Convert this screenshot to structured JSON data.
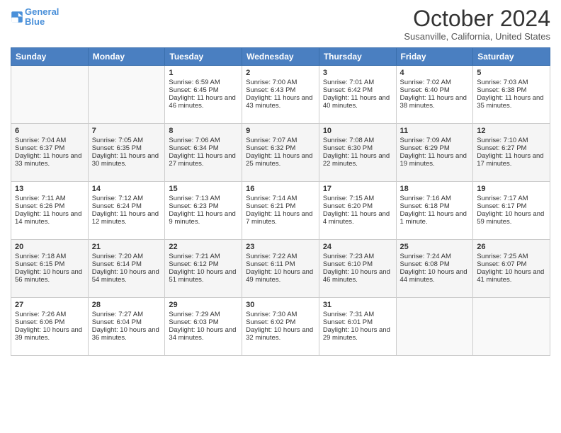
{
  "header": {
    "logo_line1": "General",
    "logo_line2": "Blue",
    "month": "October 2024",
    "location": "Susanville, California, United States"
  },
  "days_of_week": [
    "Sunday",
    "Monday",
    "Tuesday",
    "Wednesday",
    "Thursday",
    "Friday",
    "Saturday"
  ],
  "weeks": [
    [
      {
        "day": "",
        "sunrise": "",
        "sunset": "",
        "daylight": ""
      },
      {
        "day": "",
        "sunrise": "",
        "sunset": "",
        "daylight": ""
      },
      {
        "day": "1",
        "sunrise": "Sunrise: 6:59 AM",
        "sunset": "Sunset: 6:45 PM",
        "daylight": "Daylight: 11 hours and 46 minutes."
      },
      {
        "day": "2",
        "sunrise": "Sunrise: 7:00 AM",
        "sunset": "Sunset: 6:43 PM",
        "daylight": "Daylight: 11 hours and 43 minutes."
      },
      {
        "day": "3",
        "sunrise": "Sunrise: 7:01 AM",
        "sunset": "Sunset: 6:42 PM",
        "daylight": "Daylight: 11 hours and 40 minutes."
      },
      {
        "day": "4",
        "sunrise": "Sunrise: 7:02 AM",
        "sunset": "Sunset: 6:40 PM",
        "daylight": "Daylight: 11 hours and 38 minutes."
      },
      {
        "day": "5",
        "sunrise": "Sunrise: 7:03 AM",
        "sunset": "Sunset: 6:38 PM",
        "daylight": "Daylight: 11 hours and 35 minutes."
      }
    ],
    [
      {
        "day": "6",
        "sunrise": "Sunrise: 7:04 AM",
        "sunset": "Sunset: 6:37 PM",
        "daylight": "Daylight: 11 hours and 33 minutes."
      },
      {
        "day": "7",
        "sunrise": "Sunrise: 7:05 AM",
        "sunset": "Sunset: 6:35 PM",
        "daylight": "Daylight: 11 hours and 30 minutes."
      },
      {
        "day": "8",
        "sunrise": "Sunrise: 7:06 AM",
        "sunset": "Sunset: 6:34 PM",
        "daylight": "Daylight: 11 hours and 27 minutes."
      },
      {
        "day": "9",
        "sunrise": "Sunrise: 7:07 AM",
        "sunset": "Sunset: 6:32 PM",
        "daylight": "Daylight: 11 hours and 25 minutes."
      },
      {
        "day": "10",
        "sunrise": "Sunrise: 7:08 AM",
        "sunset": "Sunset: 6:30 PM",
        "daylight": "Daylight: 11 hours and 22 minutes."
      },
      {
        "day": "11",
        "sunrise": "Sunrise: 7:09 AM",
        "sunset": "Sunset: 6:29 PM",
        "daylight": "Daylight: 11 hours and 19 minutes."
      },
      {
        "day": "12",
        "sunrise": "Sunrise: 7:10 AM",
        "sunset": "Sunset: 6:27 PM",
        "daylight": "Daylight: 11 hours and 17 minutes."
      }
    ],
    [
      {
        "day": "13",
        "sunrise": "Sunrise: 7:11 AM",
        "sunset": "Sunset: 6:26 PM",
        "daylight": "Daylight: 11 hours and 14 minutes."
      },
      {
        "day": "14",
        "sunrise": "Sunrise: 7:12 AM",
        "sunset": "Sunset: 6:24 PM",
        "daylight": "Daylight: 11 hours and 12 minutes."
      },
      {
        "day": "15",
        "sunrise": "Sunrise: 7:13 AM",
        "sunset": "Sunset: 6:23 PM",
        "daylight": "Daylight: 11 hours and 9 minutes."
      },
      {
        "day": "16",
        "sunrise": "Sunrise: 7:14 AM",
        "sunset": "Sunset: 6:21 PM",
        "daylight": "Daylight: 11 hours and 7 minutes."
      },
      {
        "day": "17",
        "sunrise": "Sunrise: 7:15 AM",
        "sunset": "Sunset: 6:20 PM",
        "daylight": "Daylight: 11 hours and 4 minutes."
      },
      {
        "day": "18",
        "sunrise": "Sunrise: 7:16 AM",
        "sunset": "Sunset: 6:18 PM",
        "daylight": "Daylight: 11 hours and 1 minute."
      },
      {
        "day": "19",
        "sunrise": "Sunrise: 7:17 AM",
        "sunset": "Sunset: 6:17 PM",
        "daylight": "Daylight: 10 hours and 59 minutes."
      }
    ],
    [
      {
        "day": "20",
        "sunrise": "Sunrise: 7:18 AM",
        "sunset": "Sunset: 6:15 PM",
        "daylight": "Daylight: 10 hours and 56 minutes."
      },
      {
        "day": "21",
        "sunrise": "Sunrise: 7:20 AM",
        "sunset": "Sunset: 6:14 PM",
        "daylight": "Daylight: 10 hours and 54 minutes."
      },
      {
        "day": "22",
        "sunrise": "Sunrise: 7:21 AM",
        "sunset": "Sunset: 6:12 PM",
        "daylight": "Daylight: 10 hours and 51 minutes."
      },
      {
        "day": "23",
        "sunrise": "Sunrise: 7:22 AM",
        "sunset": "Sunset: 6:11 PM",
        "daylight": "Daylight: 10 hours and 49 minutes."
      },
      {
        "day": "24",
        "sunrise": "Sunrise: 7:23 AM",
        "sunset": "Sunset: 6:10 PM",
        "daylight": "Daylight: 10 hours and 46 minutes."
      },
      {
        "day": "25",
        "sunrise": "Sunrise: 7:24 AM",
        "sunset": "Sunset: 6:08 PM",
        "daylight": "Daylight: 10 hours and 44 minutes."
      },
      {
        "day": "26",
        "sunrise": "Sunrise: 7:25 AM",
        "sunset": "Sunset: 6:07 PM",
        "daylight": "Daylight: 10 hours and 41 minutes."
      }
    ],
    [
      {
        "day": "27",
        "sunrise": "Sunrise: 7:26 AM",
        "sunset": "Sunset: 6:06 PM",
        "daylight": "Daylight: 10 hours and 39 minutes."
      },
      {
        "day": "28",
        "sunrise": "Sunrise: 7:27 AM",
        "sunset": "Sunset: 6:04 PM",
        "daylight": "Daylight: 10 hours and 36 minutes."
      },
      {
        "day": "29",
        "sunrise": "Sunrise: 7:29 AM",
        "sunset": "Sunset: 6:03 PM",
        "daylight": "Daylight: 10 hours and 34 minutes."
      },
      {
        "day": "30",
        "sunrise": "Sunrise: 7:30 AM",
        "sunset": "Sunset: 6:02 PM",
        "daylight": "Daylight: 10 hours and 32 minutes."
      },
      {
        "day": "31",
        "sunrise": "Sunrise: 7:31 AM",
        "sunset": "Sunset: 6:01 PM",
        "daylight": "Daylight: 10 hours and 29 minutes."
      },
      {
        "day": "",
        "sunrise": "",
        "sunset": "",
        "daylight": ""
      },
      {
        "day": "",
        "sunrise": "",
        "sunset": "",
        "daylight": ""
      }
    ]
  ]
}
